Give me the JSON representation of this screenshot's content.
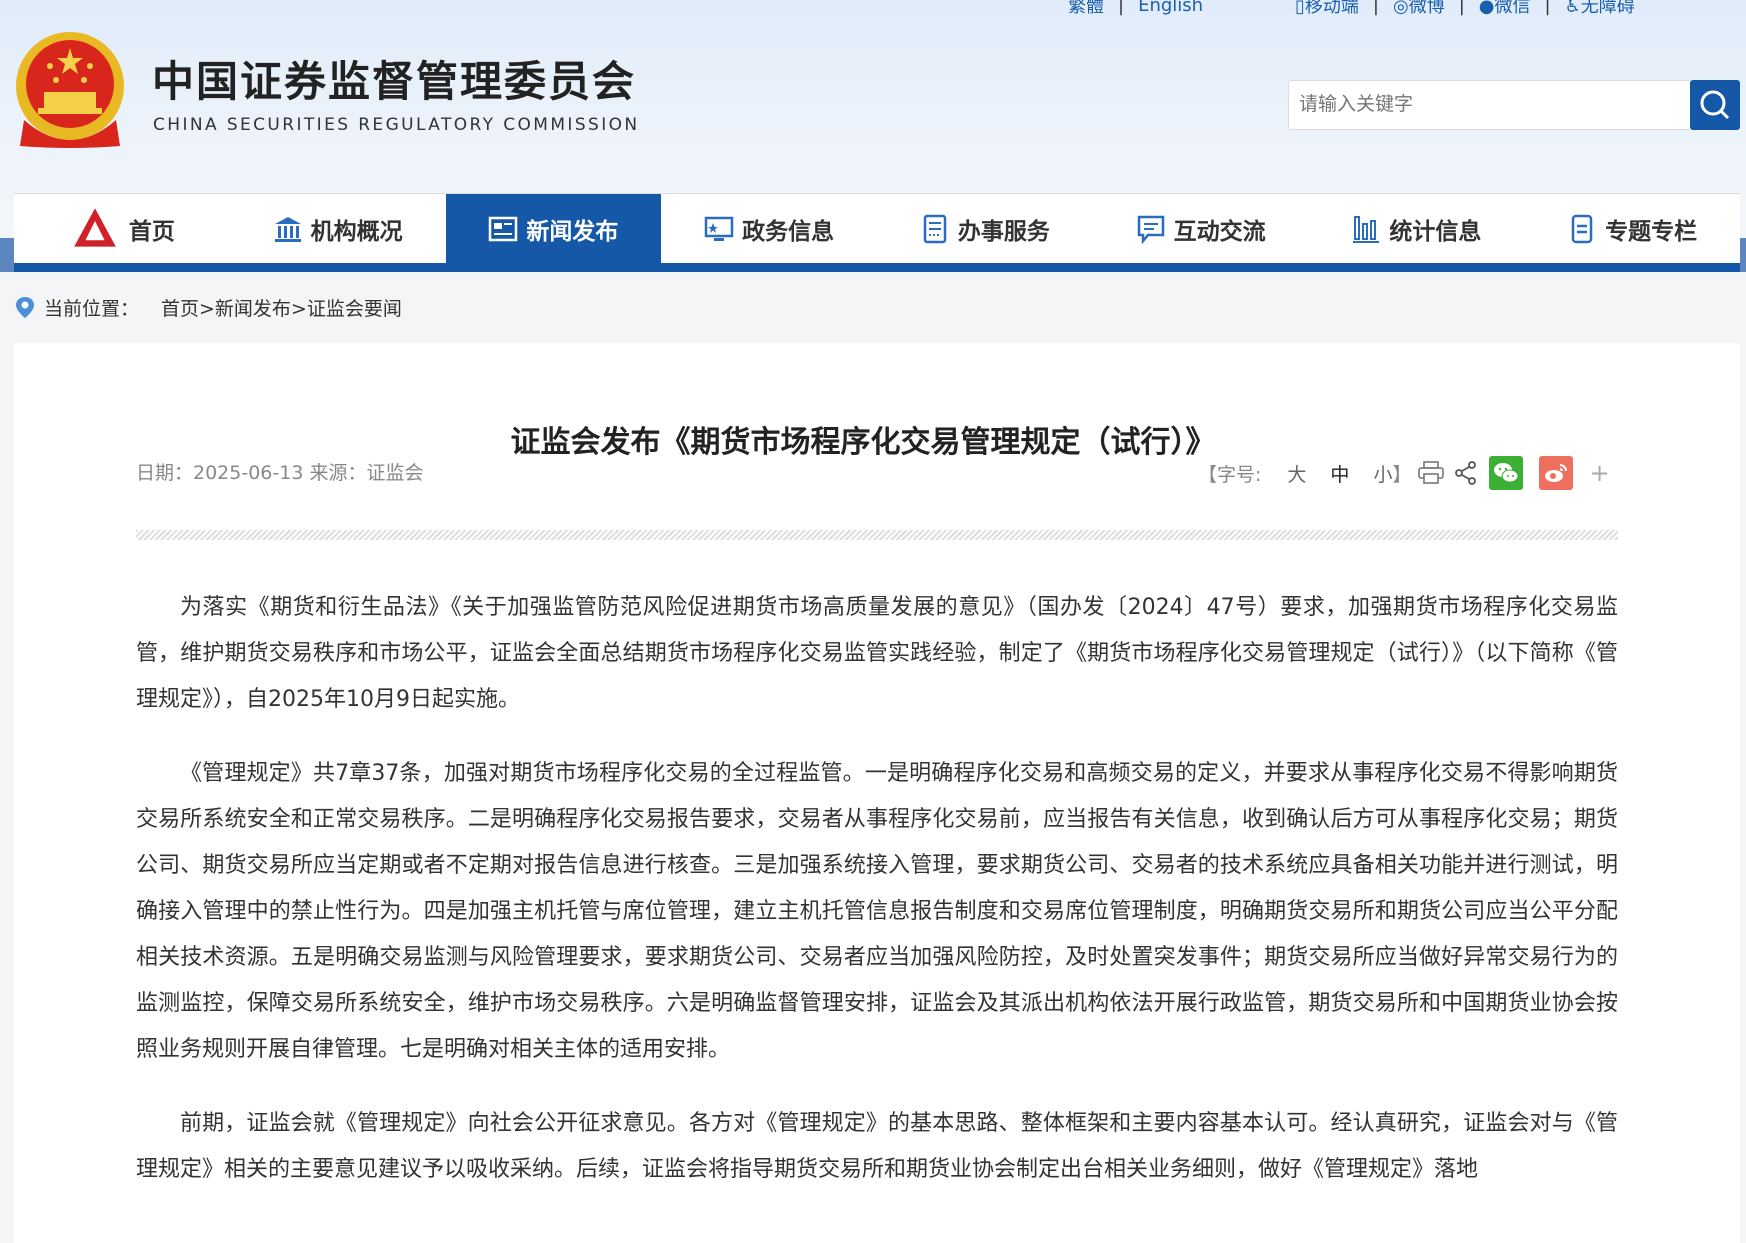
{
  "header": {
    "top_links_left": [
      "繁體",
      "English"
    ],
    "top_links_right": [
      {
        "icon": "mobile-icon",
        "label": "移动端"
      },
      {
        "icon": "weibo-icon",
        "label": "微博"
      },
      {
        "icon": "wechat-icon",
        "label": "微信"
      },
      {
        "icon": "accessibility-icon",
        "label": "无障碍"
      }
    ],
    "site_title_cn": "中国证券监督管理委员会",
    "site_title_en": "CHINA SECURITIES REGULATORY COMMISSION",
    "search_placeholder": "请输入关键字"
  },
  "nav": [
    {
      "label": "首页",
      "icon": "csrc-logo-icon"
    },
    {
      "label": "机构概况",
      "icon": "institution-icon"
    },
    {
      "label": "新闻发布",
      "icon": "news-icon",
      "active": true
    },
    {
      "label": "政务信息",
      "icon": "monitor-icon"
    },
    {
      "label": "办事服务",
      "icon": "service-icon"
    },
    {
      "label": "互动交流",
      "icon": "chat-icon"
    },
    {
      "label": "统计信息",
      "icon": "bar-chart-icon"
    },
    {
      "label": "专题专栏",
      "icon": "topic-icon"
    }
  ],
  "breadcrumb": {
    "label": "当前位置：",
    "path": "首页>新闻发布>证监会要闻"
  },
  "article": {
    "title": "证监会发布《期货市场程序化交易管理规定（试行）》",
    "meta": "日期：2025-06-13 来源：证监会",
    "font_label_open": "【字号:",
    "font_large": "大",
    "font_medium": "中",
    "font_small": "小",
    "font_label_close": "】",
    "plus": "+",
    "paragraphs": [
      "为落实《期货和衍生品法》《关于加强监管防范风险促进期货市场高质量发展的意见》（国办发〔2024〕47号）要求，加强期货市场程序化交易监管，维护期货交易秩序和市场公平，证监会全面总结期货市场程序化交易监管实践经验，制定了《期货市场程序化交易管理规定（试行）》（以下简称《管理规定》），自2025年10月9日起实施。",
      "《管理规定》共7章37条，加强对期货市场程序化交易的全过程监管。一是明确程序化交易和高频交易的定义，并要求从事程序化交易不得影响期货交易所系统安全和正常交易秩序。二是明确程序化交易报告要求，交易者从事程序化交易前，应当报告有关信息，收到确认后方可从事程序化交易；期货公司、期货交易所应当定期或者不定期对报告信息进行核查。三是加强系统接入管理，要求期货公司、交易者的技术系统应具备相关功能并进行测试，明确接入管理中的禁止性行为。四是加强主机托管与席位管理，建立主机托管信息报告制度和交易席位管理制度，明确期货交易所和期货公司应当公平分配相关技术资源。五是明确交易监测与风险管理要求，要求期货公司、交易者应当加强风险防控，及时处置突发事件；期货交易所应当做好异常交易行为的监测监控，保障交易所系统安全，维护市场交易秩序。六是明确监督管理安排，证监会及其派出机构依法开展行政监管，期货交易所和中国期货业协会按照业务规则开展自律管理。七是明确对相关主体的适用安排。",
      "前期，证监会就《管理规定》向社会公开征求意见。各方对《管理规定》的基本思路、整体框架和主要内容基本认可。经认真研究，证监会对与《管理规定》相关的主要意见建议予以吸收采纳。后续，证监会将指导期货交易所和期货业协会制定出台相关业务细则，做好《管理规定》落地"
    ]
  },
  "colors": {
    "brand_blue": "#1558a8",
    "wechat_green": "#3cb034",
    "weibo_red": "#ef6f5e"
  }
}
